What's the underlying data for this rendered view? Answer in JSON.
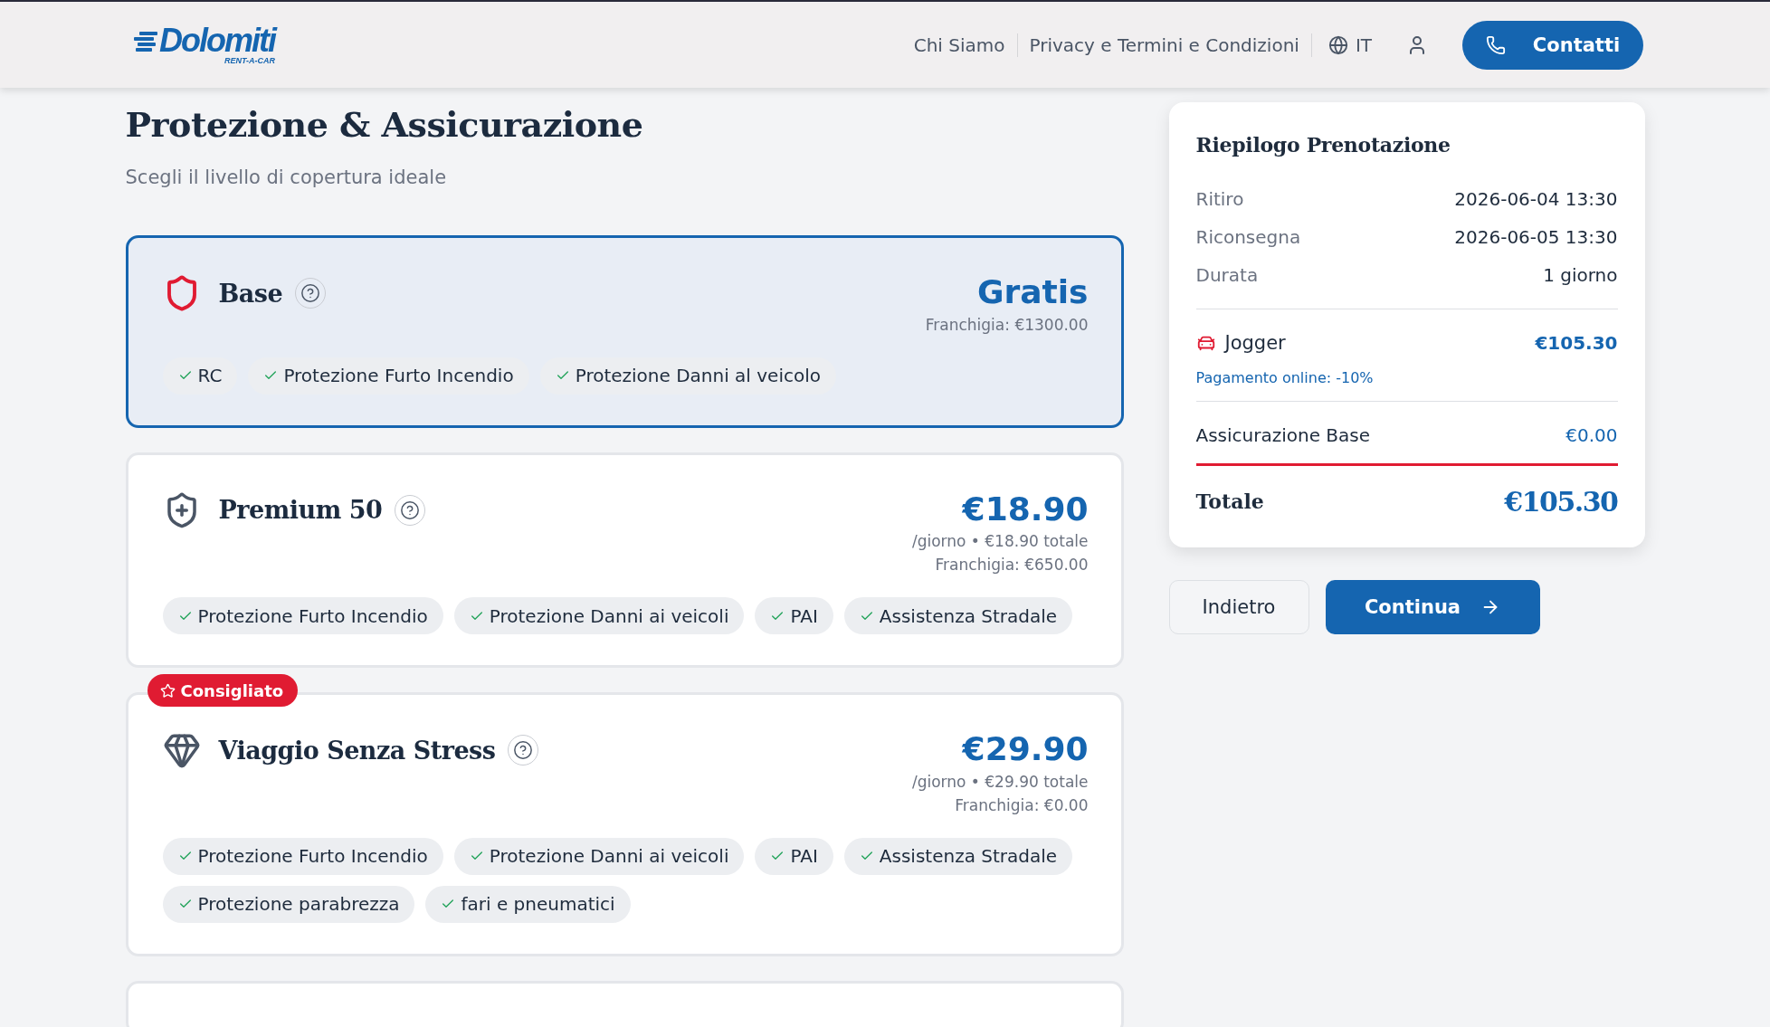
{
  "header": {
    "logo": {
      "name": "Dolomiti",
      "tagline": "RENT-A-CAR"
    },
    "nav": [
      {
        "label": "Chi Siamo"
      },
      {
        "label": "Privacy e Termini e Condizioni"
      }
    ],
    "language": "IT",
    "contact_button": "Contatti"
  },
  "page": {
    "title": "Protezione & Assicurazione",
    "subtitle": "Scegli il livello di copertura ideale"
  },
  "plans": [
    {
      "name": "Base",
      "kind": "shield",
      "selected": true,
      "price": "Gratis",
      "franchise": "Franchigia: €1300.00",
      "features": [
        "RC",
        "Protezione Furto Incendio",
        "Protezione Danni al veicolo"
      ]
    },
    {
      "name": "Premium 50",
      "kind": "shield-plus",
      "selected": false,
      "price": "€18.90",
      "per_day": "/giorno • €18.90 totale",
      "franchise": "Franchigia: €650.00",
      "features": [
        "Protezione Furto Incendio",
        "Protezione Danni ai veicoli",
        "PAI",
        "Assistenza Stradale"
      ]
    },
    {
      "name": "Viaggio Senza Stress",
      "kind": "diamond",
      "selected": false,
      "badge": "Consigliato",
      "price": "€29.90",
      "per_day": "/giorno • €29.90 totale",
      "franchise": "Franchigia: €0.00",
      "features": [
        "Protezione Furto Incendio",
        "Protezione Danni ai veicoli",
        "PAI",
        "Assistenza Stradale",
        "Protezione parabrezza",
        "fari e pneumatici"
      ]
    }
  ],
  "summary": {
    "title": "Riepilogo Prenotazione",
    "rows": [
      {
        "label": "Ritiro",
        "value": "2026-06-04 13:30"
      },
      {
        "label": "Riconsegna",
        "value": "2026-06-05 13:30"
      },
      {
        "label": "Durata",
        "value": "1 giorno"
      }
    ],
    "vehicle": {
      "name": "Jogger",
      "price": "€105.30",
      "discount": "Pagamento online: -10%"
    },
    "insurance": {
      "label": "Assicurazione Base",
      "value": "€0.00"
    },
    "total": {
      "label": "Totale",
      "value": "€105.30"
    }
  },
  "buttons": {
    "back": "Indietro",
    "continue": "Continua"
  }
}
